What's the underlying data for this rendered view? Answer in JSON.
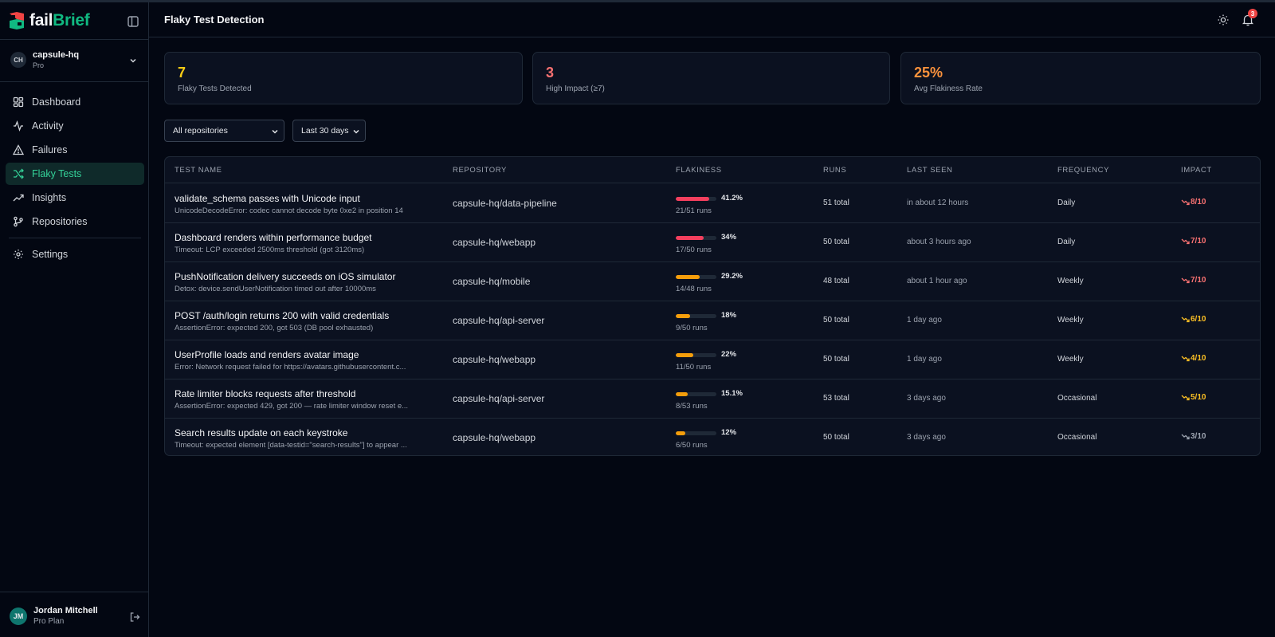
{
  "brand": {
    "name_part1": "fail",
    "name_part2": "Brief"
  },
  "org": {
    "initials": "CH",
    "name": "capsule-hq",
    "plan": "Pro"
  },
  "nav": [
    {
      "label": "Dashboard",
      "icon": "dashboard-icon",
      "active": false
    },
    {
      "label": "Activity",
      "icon": "activity-icon",
      "active": false
    },
    {
      "label": "Failures",
      "icon": "warning-icon",
      "active": false
    },
    {
      "label": "Flaky Tests",
      "icon": "shuffle-icon",
      "active": true
    },
    {
      "label": "Insights",
      "icon": "trending-up-icon",
      "active": false
    },
    {
      "label": "Repositories",
      "icon": "git-branch-icon",
      "active": false
    },
    {
      "label": "Settings",
      "icon": "gear-icon",
      "active": false
    }
  ],
  "user": {
    "initials": "JM",
    "name": "Jordan Mitchell",
    "plan": "Pro Plan"
  },
  "header": {
    "title": "Flaky Test Detection",
    "notification_count": "3"
  },
  "stats": [
    {
      "value": "7",
      "label": "Flaky Tests Detected",
      "color": "#facc15"
    },
    {
      "value": "3",
      "label": "High Impact (≥7)",
      "color": "#f87171"
    },
    {
      "value": "25%",
      "label": "Avg Flakiness Rate",
      "color": "#fb923c"
    }
  ],
  "filters": {
    "repository": "All repositories",
    "range": "Last 30 days"
  },
  "table": {
    "headers": [
      "TEST NAME",
      "REPOSITORY",
      "FLAKINESS",
      "RUNS",
      "LAST SEEN",
      "FREQUENCY",
      "IMPACT"
    ],
    "rows": [
      {
        "name": "validate_schema passes with Unicode input",
        "error": "UnicodeDecodeError: codec cannot decode byte 0xe2 in position 14",
        "repo": "capsule-hq/data-pipeline",
        "flakiness": "41.2%",
        "flakiness_value": 0.412,
        "fraction": "21/51 runs",
        "runs": "51 total",
        "last_seen": "in about 12 hours",
        "frequency": "Daily",
        "impact": "8/10",
        "impact_color": "#f87171",
        "bar_color": "#f43f5e"
      },
      {
        "name": "Dashboard renders within performance budget",
        "error": "Timeout: LCP exceeded 2500ms threshold (got 3120ms)",
        "repo": "capsule-hq/webapp",
        "flakiness": "34%",
        "flakiness_value": 0.34,
        "fraction": "17/50 runs",
        "runs": "50 total",
        "last_seen": "about 3 hours ago",
        "frequency": "Daily",
        "impact": "7/10",
        "impact_color": "#f87171",
        "bar_color": "#f43f5e"
      },
      {
        "name": "PushNotification delivery succeeds on iOS simulator",
        "error": "Detox: device.sendUserNotification timed out after 10000ms",
        "repo": "capsule-hq/mobile",
        "flakiness": "29.2%",
        "flakiness_value": 0.292,
        "fraction": "14/48 runs",
        "runs": "48 total",
        "last_seen": "about 1 hour ago",
        "frequency": "Weekly",
        "impact": "7/10",
        "impact_color": "#f87171",
        "bar_color": "#f59e0b"
      },
      {
        "name": "POST /auth/login returns 200 with valid credentials",
        "error": "AssertionError: expected 200, got 503 (DB pool exhausted)",
        "repo": "capsule-hq/api-server",
        "flakiness": "18%",
        "flakiness_value": 0.18,
        "fraction": "9/50 runs",
        "runs": "50 total",
        "last_seen": "1 day ago",
        "frequency": "Weekly",
        "impact": "6/10",
        "impact_color": "#fbbf24",
        "bar_color": "#f59e0b"
      },
      {
        "name": "UserProfile loads and renders avatar image",
        "error": "Error: Network request failed for https://avatars.githubusercontent.c...",
        "repo": "capsule-hq/webapp",
        "flakiness": "22%",
        "flakiness_value": 0.22,
        "fraction": "11/50 runs",
        "runs": "50 total",
        "last_seen": "1 day ago",
        "frequency": "Weekly",
        "impact": "4/10",
        "impact_color": "#fbbf24",
        "bar_color": "#f59e0b"
      },
      {
        "name": "Rate limiter blocks requests after threshold",
        "error": "AssertionError: expected 429, got 200 — rate limiter window reset e...",
        "repo": "capsule-hq/api-server",
        "flakiness": "15.1%",
        "flakiness_value": 0.151,
        "fraction": "8/53 runs",
        "runs": "53 total",
        "last_seen": "3 days ago",
        "frequency": "Occasional",
        "impact": "5/10",
        "impact_color": "#fbbf24",
        "bar_color": "#f59e0b"
      },
      {
        "name": "Search results update on each keystroke",
        "error": "Timeout: expected element [data-testid=\"search-results\"] to appear ...",
        "repo": "capsule-hq/webapp",
        "flakiness": "12%",
        "flakiness_value": 0.12,
        "fraction": "6/50 runs",
        "runs": "50 total",
        "last_seen": "3 days ago",
        "frequency": "Occasional",
        "impact": "3/10",
        "impact_color": "#9ca3af",
        "bar_color": "#f59e0b"
      }
    ]
  }
}
